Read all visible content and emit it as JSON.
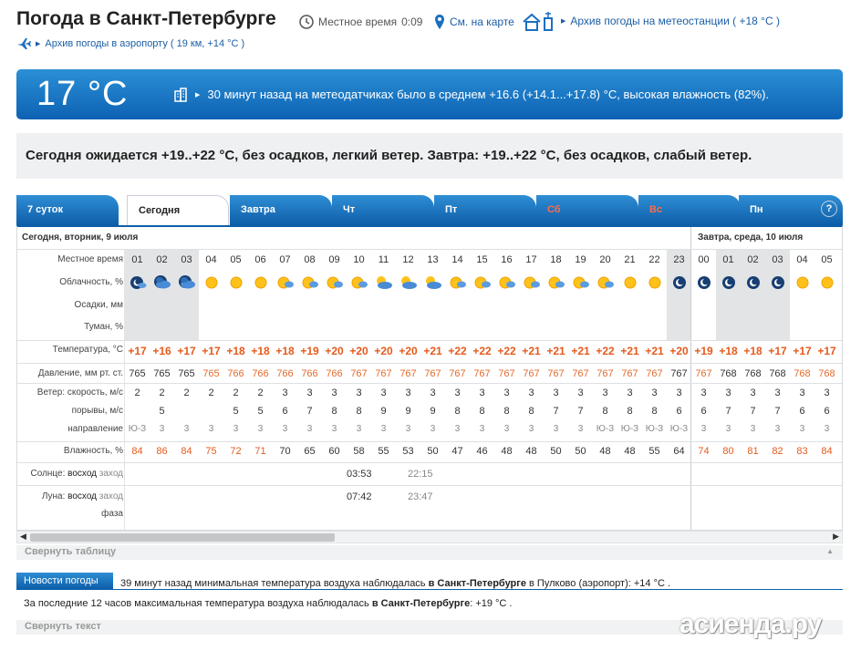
{
  "header": {
    "title": "Погода в Санкт-Петербурге",
    "local_time_label": "Местное время",
    "local_time_value": "0:09",
    "map_link": "См. на карте",
    "station_archive": "Архив погоды на метеостанции ( +18 °C )",
    "airport_archive": "Архив погоды в аэропорту ( 19 км, +14 °C )"
  },
  "current": {
    "temp": "17 °C",
    "message": "30 минут назад на метеодатчиках было в среднем +16.6 (+14.1...+17.8) °C, высокая влажность (82%)."
  },
  "forecast_text": "Сегодня ожидается +19..+22 °C, без осадков, легкий ветер. Завтра: +19..+22 °C, без осадков, слабый ветер.",
  "tabs": [
    {
      "label": "7 суток"
    },
    {
      "label": "Сегодня"
    },
    {
      "label": "Завтра"
    },
    {
      "label": "Чт"
    },
    {
      "label": "Пт"
    },
    {
      "label": "Сб"
    },
    {
      "label": "Вс"
    },
    {
      "label": "Пн"
    }
  ],
  "help_label": "?",
  "table": {
    "day1_label": "Сегодня, вторник, 9 июля",
    "day2_label": "Завтра, среда, 10 июля",
    "row_labels": {
      "time": "Местное время",
      "cloud": "Облачность, %",
      "precip": "Осадки, мм",
      "fog": "Туман, %",
      "temp": "Температура, °C",
      "pressure": "Давление, мм рт. ст.",
      "wind": "Ветер: скорость, м/с",
      "gusts": "порывы, м/с",
      "direction": "направление",
      "humidity": "Влажность, %",
      "sun_prefix": "Солнце: ",
      "sun_rise": "восход",
      "sun_set": " заход",
      "moon_prefix": "Луна: ",
      "moon_rise": "восход",
      "moon_set": " заход",
      "phase": "фаза"
    },
    "hours": [
      "01",
      "02",
      "03",
      "04",
      "05",
      "06",
      "07",
      "08",
      "09",
      "10",
      "11",
      "12",
      "13",
      "14",
      "15",
      "16",
      "17",
      "18",
      "19",
      "20",
      "21",
      "22",
      "23",
      "00",
      "01",
      "02",
      "03",
      "04",
      "05"
    ],
    "temps": [
      "+17",
      "+16",
      "+17",
      "+17",
      "+18",
      "+18",
      "+18",
      "+19",
      "+20",
      "+20",
      "+20",
      "+20",
      "+21",
      "+22",
      "+22",
      "+22",
      "+21",
      "+21",
      "+21",
      "+22",
      "+21",
      "+21",
      "+20",
      "+19",
      "+18",
      "+18",
      "+17",
      "+17",
      "+17"
    ],
    "pressure": [
      "765",
      "765",
      "765",
      "765",
      "766",
      "766",
      "766",
      "766",
      "766",
      "767",
      "767",
      "767",
      "767",
      "767",
      "767",
      "767",
      "767",
      "767",
      "767",
      "767",
      "767",
      "767",
      "767",
      "767",
      "768",
      "768",
      "768",
      "768",
      "768"
    ],
    "wind": [
      "2",
      "2",
      "2",
      "2",
      "2",
      "2",
      "3",
      "3",
      "3",
      "3",
      "3",
      "3",
      "3",
      "3",
      "3",
      "3",
      "3",
      "3",
      "3",
      "3",
      "3",
      "3",
      "3",
      "3",
      "3",
      "3",
      "3",
      "3",
      "3"
    ],
    "gusts": [
      "",
      "5",
      "",
      "",
      "5",
      "5",
      "6",
      "7",
      "8",
      "8",
      "9",
      "9",
      "9",
      "8",
      "8",
      "8",
      "8",
      "7",
      "7",
      "8",
      "8",
      "8",
      "6",
      "6",
      "7",
      "7",
      "7",
      "6",
      "6"
    ],
    "direction": [
      "Ю-З",
      "3",
      "3",
      "3",
      "3",
      "3",
      "3",
      "3",
      "3",
      "3",
      "3",
      "3",
      "3",
      "3",
      "3",
      "3",
      "3",
      "3",
      "3",
      "Ю-З",
      "Ю-З",
      "Ю-З",
      "Ю-З",
      "3",
      "3",
      "3",
      "3",
      "3",
      "3"
    ],
    "humidity": [
      "84",
      "86",
      "84",
      "75",
      "72",
      "71",
      "70",
      "65",
      "60",
      "58",
      "55",
      "53",
      "50",
      "47",
      "46",
      "48",
      "48",
      "50",
      "50",
      "48",
      "48",
      "55",
      "64",
      "74",
      "80",
      "81",
      "82",
      "83",
      "84"
    ],
    "cloud_icons": [
      "night-cloud",
      "night-cloudy",
      "night-cloudy",
      "sun",
      "sun",
      "sun",
      "sun-cloud",
      "sun-cloud",
      "sun-cloud",
      "sun-cloud",
      "sun-cloudy",
      "sun-cloudy",
      "sun-cloudy",
      "sun-cloud",
      "sun-cloud",
      "sun-cloud",
      "sun-cloud",
      "sun-cloud",
      "sun-cloud",
      "sun-cloud",
      "sun",
      "sun",
      "night-clear",
      "night-clear",
      "night-clear",
      "night-clear",
      "night-clear",
      "sun",
      "sun"
    ],
    "sunrise": "03:53",
    "sunset": "22:15",
    "moonrise": "07:42",
    "moonset": "23:47"
  },
  "collapse_table": "Свернуть таблицу",
  "news": {
    "button": "Новости погоды",
    "line1_a": "39 минут назад минимальная температура воздуха наблюдалась ",
    "line1_b": "в Санкт-Петербурге",
    "line1_c": " в Пулково (аэропорт): +14 °С .",
    "line2_a": "За последние 12 часов максимальная температура воздуха наблюдалась ",
    "line2_b": "в Санкт-Петербурге",
    "line2_c": ": +19 °С ."
  },
  "collapse_text": "Свернуть текст",
  "watermark": "асиенда.ру",
  "colors": {
    "accent": "#0d62b3",
    "temp": "#e55a1c",
    "weekend": "#ff6b4a"
  }
}
